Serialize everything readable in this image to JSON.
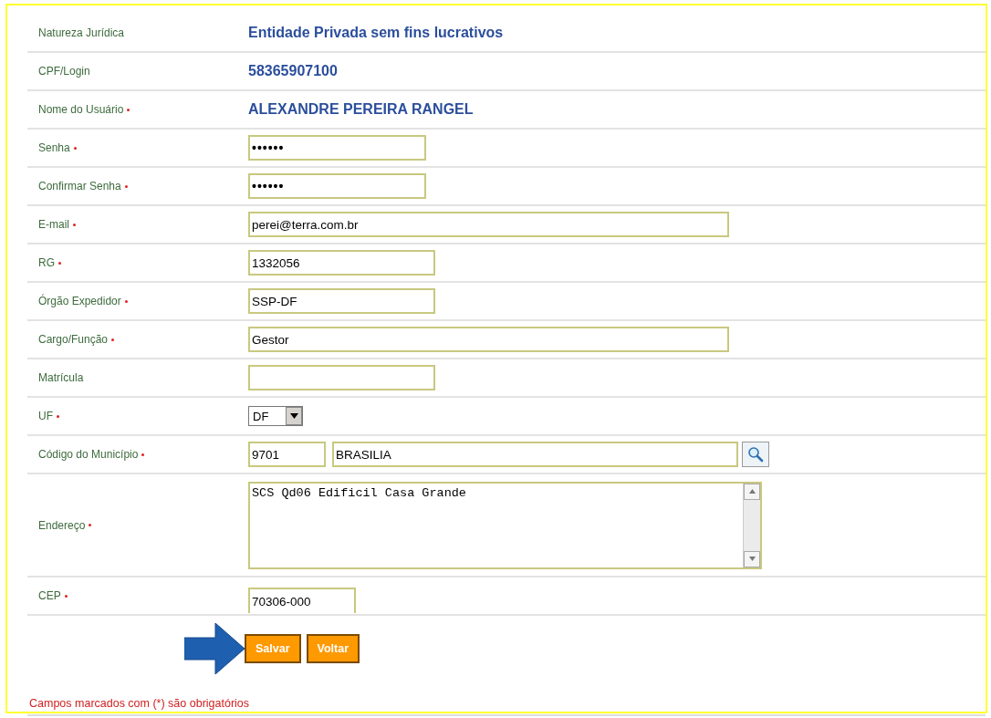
{
  "rows": [
    {
      "label": "Natureza Jurídica",
      "required": false,
      "kind": "static",
      "value": "Entidade Privada sem fins lucrativos"
    },
    {
      "label": "CPF/Login",
      "required": false,
      "kind": "static",
      "value": "58365907100"
    },
    {
      "label": "Nome do Usuário",
      "required": true,
      "kind": "static",
      "value": "ALEXANDRE PEREIRA RANGEL"
    },
    {
      "label": "Senha",
      "required": true,
      "kind": "password",
      "value": "••••••"
    },
    {
      "label": "Confirmar Senha",
      "required": true,
      "kind": "password",
      "value": "••••••"
    },
    {
      "label": "E-mail",
      "required": true,
      "kind": "wide",
      "value": "perei@terra.com.br"
    },
    {
      "label": "RG",
      "required": true,
      "kind": "medium",
      "value": "1332056"
    },
    {
      "label": "Órgão Expedidor",
      "required": true,
      "kind": "medium",
      "value": "SSP-DF"
    },
    {
      "label": "Cargo/Função",
      "required": true,
      "kind": "wide",
      "value": "Gestor"
    },
    {
      "label": "Matrícula",
      "required": false,
      "kind": "medium"
    },
    {
      "label": "UF",
      "required": true,
      "kind": "select",
      "value": "DF"
    },
    {
      "label": "Código do Município",
      "required": true,
      "kind": "municipio",
      "value": "9701",
      "value_2": "BRASILIA"
    },
    {
      "label": "Endereço",
      "required": true,
      "kind": "textarea",
      "value": "SCS Qd06 Edificil Casa Grande"
    },
    {
      "label": "CEP",
      "required": true,
      "kind": "short",
      "value": "70306-000"
    }
  ],
  "buttons": [
    "Salvar",
    "Voltar"
  ],
  "footer": "Campos marcados com (*) são obrigatórios"
}
